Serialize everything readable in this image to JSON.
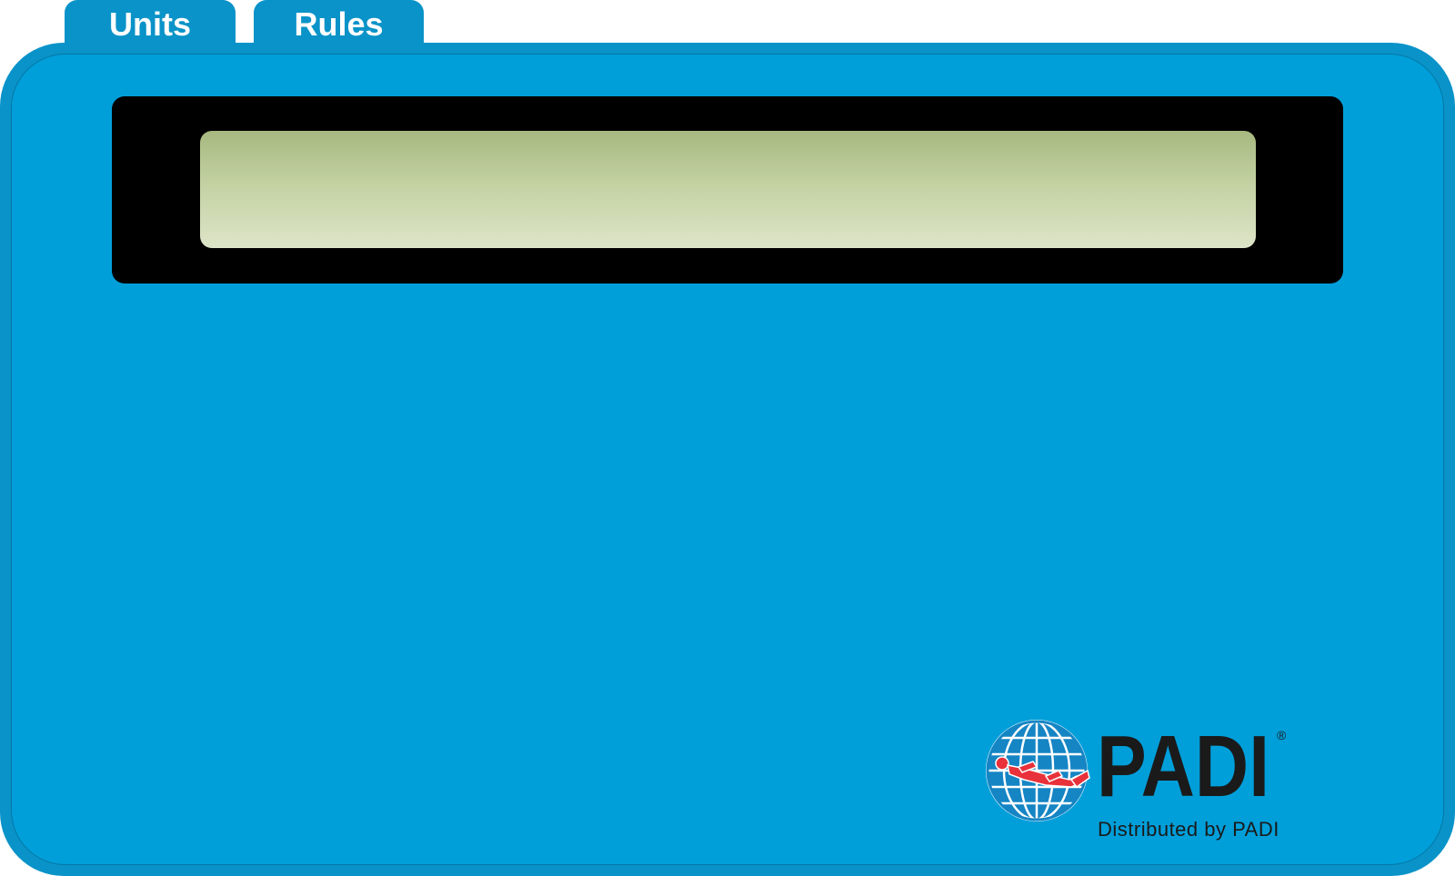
{
  "tabs": [
    {
      "label": "Units"
    },
    {
      "label": "Rules"
    }
  ],
  "display": {
    "text": ""
  },
  "brand": {
    "wordmark": "PADI",
    "registered_mark": "®",
    "tagline": "Distributed by PADI"
  },
  "colors": {
    "device_body": "#009fda",
    "device_rim": "#0a93c8",
    "bezel": "#000000",
    "lcd_top": "#a7b880",
    "lcd_bottom": "#dde5c8",
    "brand_text": "#1a1a1a",
    "diver_red": "#e8313a"
  }
}
